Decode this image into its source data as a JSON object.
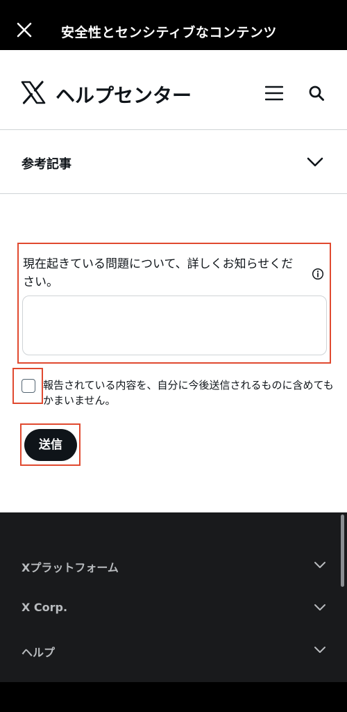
{
  "topbar": {
    "title": "安全性とセンシティブなコンテンツ"
  },
  "header": {
    "brand": "ヘルプセンター"
  },
  "related": {
    "label": "参考記事"
  },
  "form": {
    "question": "現在起きている問題について、詳しくお知らせください。",
    "textarea_value": "",
    "checkbox_label": "報告されている内容を、自分に今後送信されるものに含めてもかまいません。",
    "checkbox_checked": false,
    "submit_label": "送信"
  },
  "footer": {
    "items": [
      {
        "label": "Xプラットフォーム"
      },
      {
        "label": "X Corp."
      },
      {
        "label": "ヘルプ"
      }
    ]
  },
  "colors": {
    "highlight": "#e0492f",
    "button": "#0f1419",
    "footer_bg": "#191a1c"
  }
}
